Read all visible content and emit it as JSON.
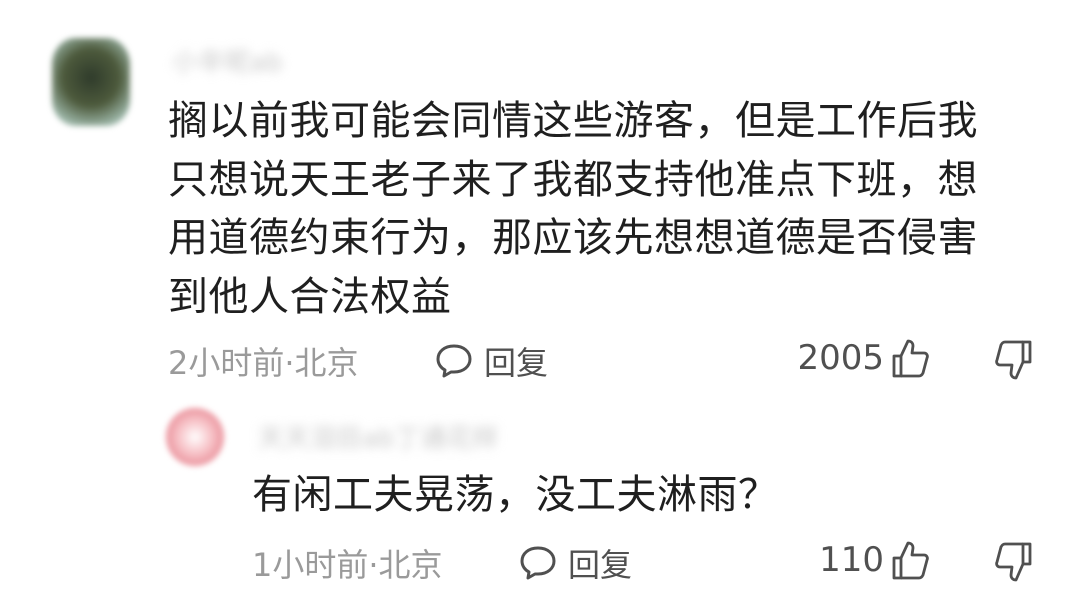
{
  "comment": {
    "author_name_blurred": "小辛呢ab",
    "text_lines": [
      "搁以前我可能会同情这些游客，但是工作后我",
      "只想说天王老子来了我都支持他准点下班，想",
      "用道德约束行为，那应该先想想道德是否侵害",
      "到他人合法权益"
    ],
    "meta": "2小时前·北京",
    "reply_label": "回复",
    "like_count": "2005"
  },
  "reply": {
    "author_name_blurred": "天天泪目ab丁通花样",
    "text": "有闲工夫晃荡，没工夫淋雨？",
    "meta": "1小时前·北京",
    "reply_label": "回复",
    "like_count": "110"
  },
  "icons": {
    "reply": "speech-bubble-icon",
    "like": "thumbs-up-icon",
    "dislike": "thumbs-down-icon"
  }
}
